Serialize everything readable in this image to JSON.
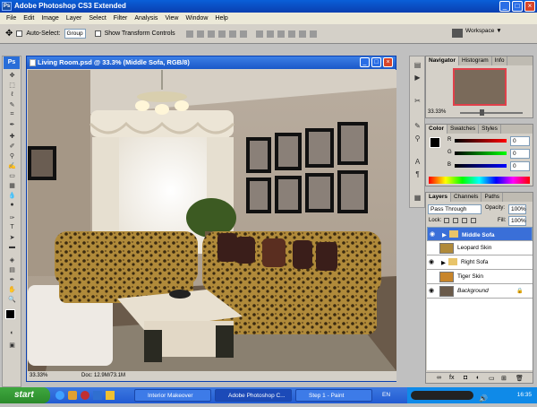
{
  "app": {
    "title": "Adobe Photoshop CS3 Extended",
    "icon_label": "Ps"
  },
  "menu": [
    "File",
    "Edit",
    "Image",
    "Layer",
    "Select",
    "Filter",
    "Analysis",
    "View",
    "Window",
    "Help"
  ],
  "options_bar": {
    "auto_select_label": "Auto-Select:",
    "auto_select_value": "Group",
    "show_transform_label": "Show Transform Controls",
    "workspace_label": "Workspace ▼"
  },
  "document": {
    "title": "Living Room.psd @ 33.3% (Middle Sofa, RGB/8)",
    "zoom": "33.33%",
    "doc_info": "Doc: 12.9M/73.1M"
  },
  "navigator": {
    "tabs": [
      "Navigator",
      "Histogram",
      "Info"
    ],
    "zoom": "33.33%"
  },
  "color_panel": {
    "tabs": [
      "Color",
      "Swatches",
      "Styles"
    ],
    "channels": [
      {
        "label": "R",
        "value": "0"
      },
      {
        "label": "G",
        "value": "0"
      },
      {
        "label": "B",
        "value": "0"
      }
    ]
  },
  "layers_panel": {
    "tabs": [
      "Layers",
      "Channels",
      "Paths"
    ],
    "blend_mode": "Pass Through",
    "opacity_label": "Opacity:",
    "opacity_value": "100%",
    "lock_label": "Lock:",
    "fill_label": "Fill:",
    "fill_value": "100%",
    "layers": [
      {
        "name": "Middle Sofa",
        "type": "group",
        "selected": true
      },
      {
        "name": "Leopard Skin",
        "type": "layer",
        "selected": false
      },
      {
        "name": "Right Sofa",
        "type": "group",
        "selected": false
      },
      {
        "name": "Tiger Skin",
        "type": "layer",
        "selected": false
      },
      {
        "name": "Background",
        "type": "background",
        "selected": false
      }
    ]
  },
  "taskbar": {
    "start_label": "start",
    "tasks": [
      {
        "label": "Interior Makeover"
      },
      {
        "label": "Adobe Photoshop C..."
      },
      {
        "label": "Step 1 - Paint"
      }
    ],
    "language": "EN",
    "clock": "16:35"
  },
  "colors": {
    "titlebar_blue": "#0a3fb0",
    "selected_layer": "#3a6fd8",
    "start_green": "#3fa83f"
  }
}
